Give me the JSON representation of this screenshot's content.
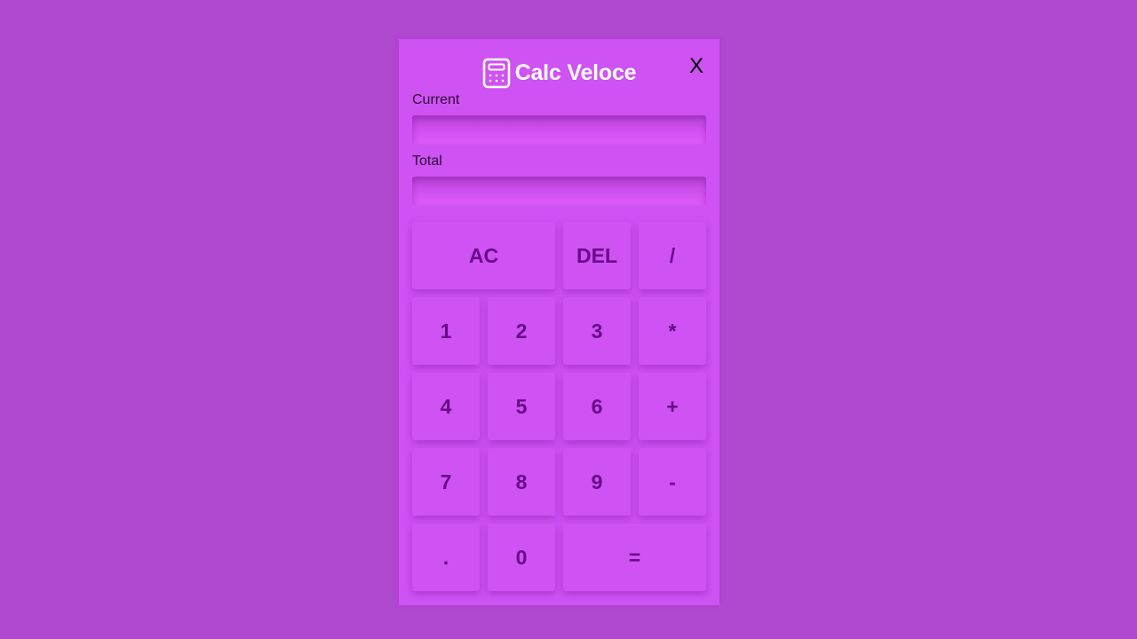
{
  "app": {
    "title": "Calc Veloce",
    "close_label": "X"
  },
  "fields": {
    "current_label": "Current",
    "current_value": "",
    "total_label": "Total",
    "total_value": ""
  },
  "keys": {
    "ac": "AC",
    "del": "DEL",
    "divide": "/",
    "one": "1",
    "two": "2",
    "three": "3",
    "multiply": "*",
    "four": "4",
    "five": "5",
    "six": "6",
    "plus": "+",
    "seven": "7",
    "eight": "8",
    "nine": "9",
    "minus": "-",
    "dot": ".",
    "zero": "0",
    "equals": "="
  },
  "colors": {
    "background": "#b049d0",
    "panel": "#cf52f3",
    "key_text": "#6a0a8a",
    "title_text": "#ffffff"
  },
  "icons": {
    "logo": "calculator-icon"
  }
}
